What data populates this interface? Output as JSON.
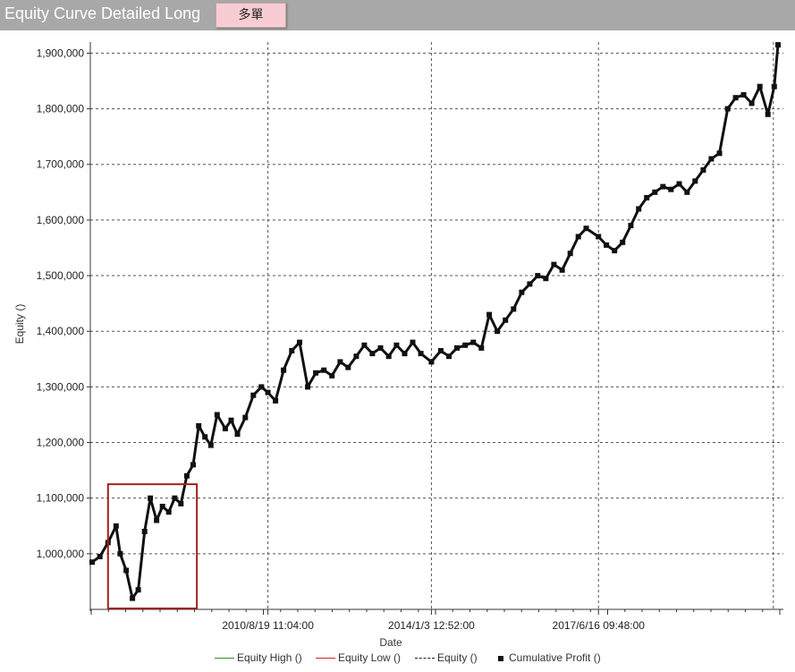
{
  "header": {
    "title": "Equity Curve Detailed Long",
    "tab_label": "多單"
  },
  "colors": {
    "equity_high": "#2e8b2e",
    "equity_low": "#d62020",
    "equity": "#222222",
    "cumulative_profit": "#111111",
    "highlight_box": "#a02020"
  },
  "chart_data": {
    "type": "line",
    "xlabel": "Date",
    "ylabel": "Equity ()",
    "xticks": [
      "2010/8/19 11:04:00",
      "2014/1/3 12:52:00",
      "2017/6/16 09:48:00"
    ],
    "yticks": [
      "1,000,000",
      "1,100,000",
      "1,200,000",
      "1,300,000",
      "1,400,000",
      "1,500,000",
      "1,600,000",
      "1,700,000",
      "1,800,000",
      "1,900,000"
    ],
    "ylim": [
      900000,
      1920000
    ],
    "grid": true,
    "legend": {
      "placement": "bottom",
      "entries": [
        "Equity High ()",
        "Equity Low ()",
        "Equity ()",
        "Cumulative Profit ()"
      ]
    },
    "series": [
      {
        "name": "Cumulative Profit ()",
        "x": [
          "2007/1/1",
          "2007/3/1",
          "2007/5/1",
          "2007/7/1",
          "2007/8/1",
          "2007/9/15",
          "2007/11/1",
          "2007/12/15",
          "2008/2/1",
          "2008/3/15",
          "2008/5/1",
          "2008/6/15",
          "2008/8/1",
          "2008/9/15",
          "2008/11/1",
          "2008/12/15",
          "2009/2/1",
          "2009/3/15",
          "2009/5/1",
          "2009/6/15",
          "2009/8/1",
          "2009/10/1",
          "2009/11/15",
          "2010/1/1",
          "2010/3/1",
          "2010/5/1",
          "2010/7/1",
          "2010/8/19",
          "2010/10/15",
          "2010/12/15",
          "2011/2/15",
          "2011/4/15",
          "2011/6/15",
          "2011/8/15",
          "2011/10/15",
          "2011/12/15",
          "2012/2/15",
          "2012/4/15",
          "2012/6/15",
          "2012/8/15",
          "2012/10/15",
          "2012/12/15",
          "2013/2/15",
          "2013/4/15",
          "2013/6/15",
          "2013/8/15",
          "2013/10/15",
          "2014/1/3",
          "2014/3/15",
          "2014/5/15",
          "2014/7/15",
          "2014/9/15",
          "2014/11/15",
          "2015/1/15",
          "2015/3/15",
          "2015/5/15",
          "2015/7/15",
          "2015/9/15",
          "2015/11/15",
          "2016/1/15",
          "2016/3/15",
          "2016/5/15",
          "2016/7/15",
          "2016/9/15",
          "2016/11/15",
          "2017/1/15",
          "2017/3/15",
          "2017/6/16",
          "2017/8/15",
          "2017/10/15",
          "2017/12/15",
          "2018/2/15",
          "2018/4/15",
          "2018/6/15",
          "2018/8/15",
          "2018/10/15",
          "2018/12/15",
          "2019/2/15",
          "2019/4/15",
          "2019/6/15",
          "2019/8/15",
          "2019/10/15",
          "2019/12/15",
          "2020/2/15",
          "2020/4/15",
          "2020/6/15",
          "2020/8/15",
          "2020/10/15",
          "2020/12/15",
          "2021/2/1",
          "2021/3/1"
        ],
        "values": [
          985000,
          995000,
          1020000,
          1050000,
          1000000,
          970000,
          920000,
          935000,
          1040000,
          1100000,
          1060000,
          1085000,
          1075000,
          1100000,
          1090000,
          1140000,
          1160000,
          1230000,
          1210000,
          1195000,
          1250000,
          1225000,
          1240000,
          1215000,
          1245000,
          1285000,
          1300000,
          1290000,
          1275000,
          1330000,
          1365000,
          1380000,
          1300000,
          1325000,
          1330000,
          1320000,
          1345000,
          1335000,
          1355000,
          1375000,
          1360000,
          1370000,
          1355000,
          1375000,
          1360000,
          1380000,
          1360000,
          1345000,
          1365000,
          1355000,
          1370000,
          1375000,
          1380000,
          1370000,
          1430000,
          1400000,
          1420000,
          1440000,
          1470000,
          1485000,
          1500000,
          1495000,
          1520000,
          1510000,
          1540000,
          1570000,
          1585000,
          1570000,
          1555000,
          1545000,
          1560000,
          1590000,
          1620000,
          1640000,
          1650000,
          1660000,
          1655000,
          1665000,
          1650000,
          1670000,
          1690000,
          1710000,
          1720000,
          1800000,
          1820000,
          1825000,
          1810000,
          1840000,
          1790000,
          1840000,
          1915000
        ]
      }
    ],
    "annotations": [
      {
        "type": "highlight-box",
        "x_range": [
          "2007/5/1",
          "2009/3/1"
        ],
        "y_range": [
          995000,
          1125000
        ]
      }
    ]
  }
}
